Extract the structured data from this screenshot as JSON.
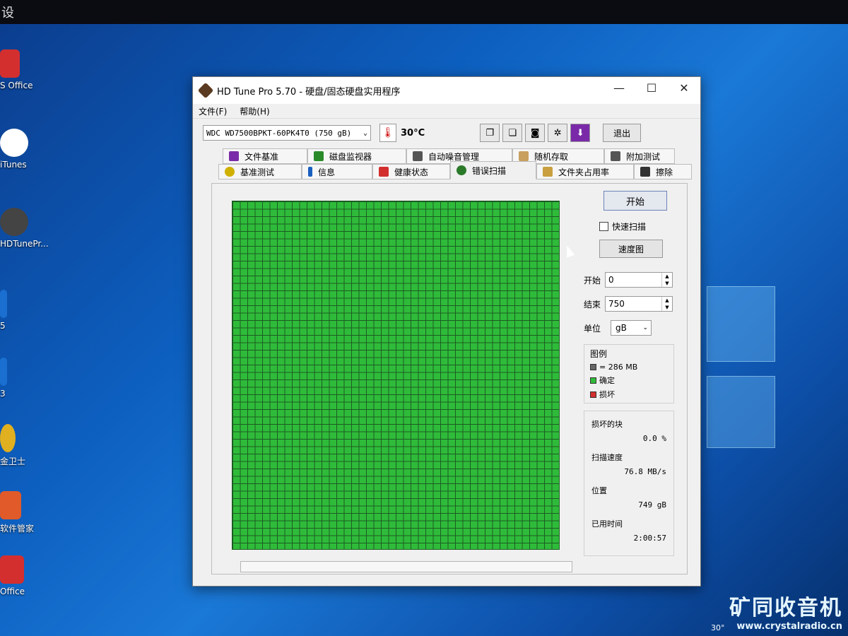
{
  "desktop": {
    "top_glyph": "设",
    "icons": [
      {
        "label": "S Office",
        "color": "#d32f2f"
      },
      {
        "label": "iTunes",
        "color": "#e05ad0"
      },
      {
        "label": "HDTunePr...",
        "color": "#444444"
      },
      {
        "label": "5",
        "color": "#1a6fd1"
      },
      {
        "label": "3",
        "color": "#1a6fd1"
      },
      {
        "label": "金卫士",
        "color": "#e0b020"
      },
      {
        "label": "软件管家",
        "color": "#e05a2a"
      },
      {
        "label": "Office",
        "color": "#d32f2f"
      }
    ],
    "watermark_title": "矿同收音机",
    "watermark_url": "www.crystalradio.cn",
    "tray_text": "30°"
  },
  "window": {
    "title": "HD Tune Pro 5.70 - 硬盘/固态硬盘实用程序",
    "minimize": "—",
    "maximize": "☐",
    "close": "✕",
    "menu": [
      "文件(F)",
      "帮助(H)"
    ],
    "drive": "WDC WD7500BPKT-60PK4T0 (750 gB)",
    "temperature": "30°C",
    "exit_label": "退出",
    "toolbar_icons": [
      "copy-icon",
      "copy-info-icon",
      "camera-icon",
      "settings-icon",
      "download-icon"
    ]
  },
  "tabs": {
    "back_row": [
      {
        "label": "文件基准",
        "color": "#7a2aa8"
      },
      {
        "label": "磁盘监视器",
        "color": "#2a8a2a"
      },
      {
        "label": "自动噪音管理",
        "color": "#555555"
      },
      {
        "label": "随机存取",
        "color": "#c8a060"
      },
      {
        "label": "附加测试",
        "color": "#555555"
      }
    ],
    "front_row": [
      {
        "label": "基准测试",
        "color": "#d0b000"
      },
      {
        "label": "信息",
        "color": "#1a5fbf"
      },
      {
        "label": "健康状态",
        "color": "#d32f2f"
      },
      {
        "label": "错误扫描",
        "color": "#2a7a2a",
        "active": true
      },
      {
        "label": "文件夹占用率",
        "color": "#c8a040"
      },
      {
        "label": "擦除",
        "color": "#333333"
      }
    ]
  },
  "scan": {
    "start_label": "开始",
    "quick_scan_label": "快速扫描",
    "speed_map_label": "速度图",
    "start_field_label": "开始",
    "start_value": "0",
    "end_field_label": "结束",
    "end_value": "750",
    "unit_label": "单位",
    "unit_value": "gB",
    "legend_title": "图例",
    "legend_block": "= 286 MB",
    "legend_ok": "确定",
    "legend_bad": "损坏",
    "bad_blocks_label": "损坏的块",
    "bad_blocks_value": "0.0 %",
    "scan_speed_label": "扫描速度",
    "scan_speed_value": "76.8 MB/s",
    "position_label": "位置",
    "position_value": "749 gB",
    "elapsed_label": "已用时间",
    "elapsed_value": "2:00:57",
    "ok_color": "#2fbb3a",
    "bad_color": "#d32f2f",
    "block_color": "#666666"
  }
}
